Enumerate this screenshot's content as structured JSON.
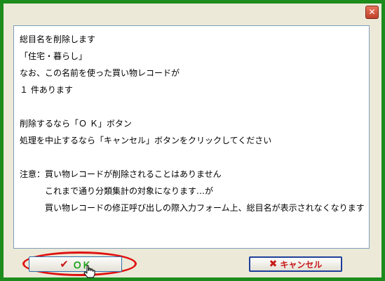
{
  "dialog": {
    "close_glyph": "✕",
    "message_lines": [
      "総目名を削除します",
      "「住宅・暮らし」",
      "なお、この名前を使った買い物レコードが",
      "１ 件あります",
      "",
      "削除するなら「Ｏ Ｋ」ボタン",
      "処理を中止するなら「キャンセル」ボタンをクリックしてください",
      "",
      "注意：買い物レコードが削除されることはありません"
    ],
    "note_lines": [
      "これまで通り分類集計の対象になります…が",
      "買い物レコードの修正呼び出しの際入力フォーム上、総目名が表示されなくなります"
    ],
    "ok_label": "ＯＫ",
    "cancel_label": "キャンセル"
  },
  "colors": {
    "background": "#1c8c1c",
    "ok_text": "#18a018",
    "cancel_text": "#c81818",
    "highlight_ring": "#e01010"
  },
  "icons": {
    "ok": "check-icon",
    "cancel": "x-icon",
    "close": "close-icon",
    "cursor": "hand-cursor-icon"
  }
}
